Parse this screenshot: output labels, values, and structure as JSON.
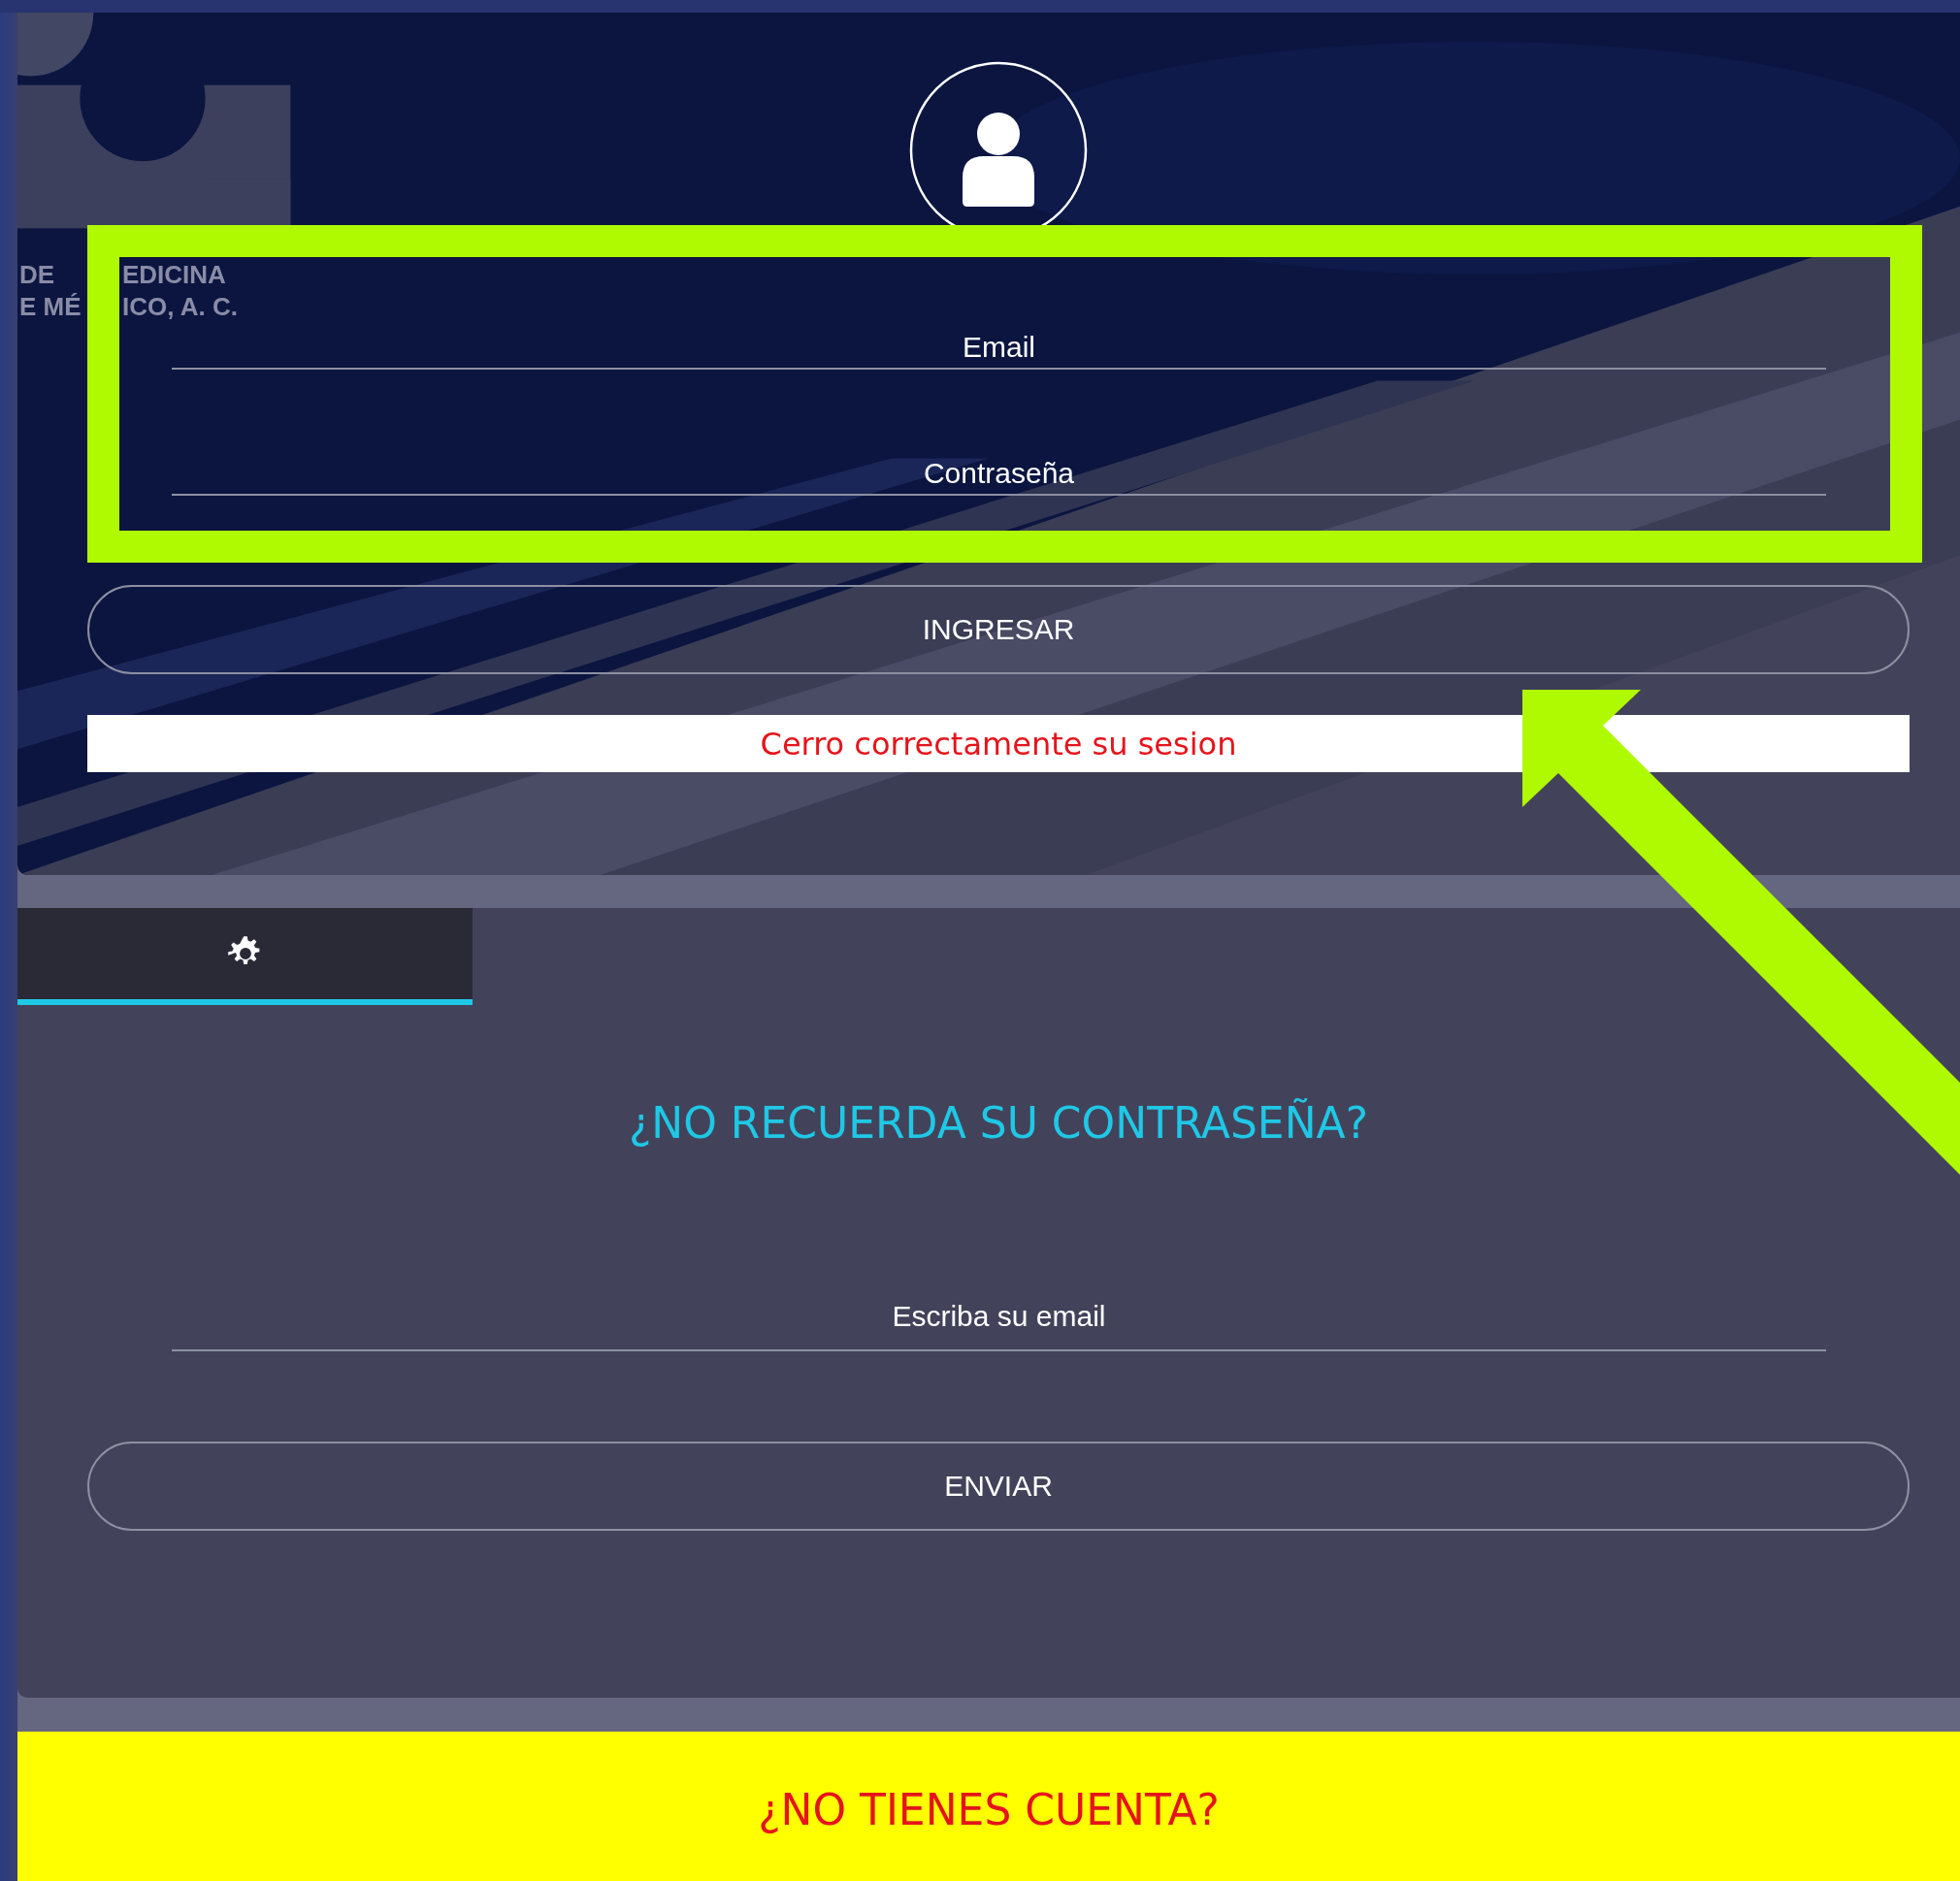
{
  "logo": {
    "lines": [
      [
        "DE",
        "EDICINA"
      ],
      [
        "E MÉ",
        "ICO, A. C."
      ]
    ]
  },
  "login": {
    "fields": [
      {
        "placeholder": "Email"
      },
      {
        "placeholder": "Contraseña"
      }
    ],
    "button": "INGRESAR",
    "message": "Cerro correctamente su sesion"
  },
  "tabs": [
    {
      "selected": true
    }
  ],
  "recover": {
    "title": "¿NO RECUERDA SU CONTRASEÑA?",
    "field": {
      "placeholder": "Escriba su email"
    },
    "button": "ENVIAR"
  },
  "signup": {
    "title": "¿NO TIENES CUENTA?"
  },
  "annotation": {
    "box": true,
    "arrow": true
  }
}
